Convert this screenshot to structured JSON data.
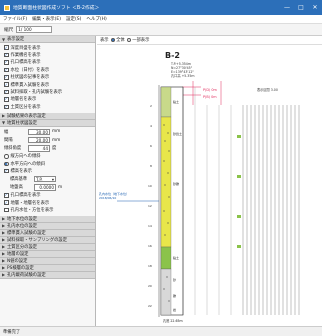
{
  "window": {
    "title": "地質断面柱状図作成ソフト ＜B-2作成＞",
    "controls": {
      "minimize": "—",
      "maximize": "□",
      "close": "✕"
    }
  },
  "menu": [
    "ファイル(F)",
    "編集・表示(E)",
    "設定(S)",
    "ヘルプ(H)"
  ],
  "toolbar": {
    "scale_label": "縮尺",
    "scale_value": "1/ 100"
  },
  "left_panel": {
    "display_settings": {
      "header": "表示設定",
      "items": [
        {
          "label": "深度目盛を表示",
          "checked": true
        },
        {
          "label": "作業機名を表示",
          "checked": true
        },
        {
          "label": "孔口標高を表示",
          "checked": true
        },
        {
          "label": "水位（日付）を表示",
          "checked": true
        },
        {
          "label": "柱状図の記事を表示",
          "checked": true
        },
        {
          "label": "標準貫入試験を表示",
          "checked": true
        },
        {
          "label": "試料採取・孔内試験を表示",
          "checked": true
        },
        {
          "label": "地層名を表示",
          "checked": true
        },
        {
          "label": "土質区分を表示",
          "checked": true
        }
      ]
    },
    "test_display_header": "試験結果の表示設定",
    "geology_settings": {
      "header": "地質柱状図設定",
      "width_label": "幅",
      "width_value": "30.00",
      "width_unit": "mm",
      "spacing_label": "間隔",
      "spacing_value": "20.00",
      "spacing_unit": "mm",
      "angle_label": "傾斜角度",
      "angle_value": "44",
      "angle_unit": "度",
      "radio_options": [
        {
          "label": "縦方向への傾斜",
          "selected": false
        },
        {
          "label": "水平方向への傾斜",
          "selected": true
        }
      ],
      "elevation_checkbox": "標高を表示",
      "elevation_ref_label": "標高基準",
      "elevation_ref_value": "T.P.",
      "ground_level_label": "地盤高",
      "ground_level_value": "0.0000",
      "ground_level_unit": "m",
      "extra_items": [
        {
          "label": "孔口標高を表示",
          "checked": true
        },
        {
          "label": "地層・地層名を表示",
          "checked": true
        },
        {
          "label": "孔内水位・方位を表示",
          "checked": false
        }
      ]
    },
    "collapsed_sections": [
      "地下水位の設定",
      "孔内水位の設定",
      "標準貫入試験の設定",
      "試料採取・サンプリングの設定",
      "土質区分の設定",
      "地層の設定",
      "N値の設定",
      "PS検層の設定",
      "孔内載荷試験の設定"
    ]
  },
  "main": {
    "view_label": "表示",
    "view_options": [
      {
        "label": "全体",
        "selected": true
      },
      {
        "label": "一部表示",
        "selected": false
      }
    ]
  },
  "drawing": {
    "borehole_name": "B-2",
    "header_info": [
      "T.P.+5.354m",
      "N=27°30'45\"",
      "E=139°43'12\"",
      "孔口高 +5.35m"
    ],
    "notes_top": "P(D) 0m",
    "notes_second": "P(B) 0m",
    "left_label": "孔内水位（地下水位）",
    "left_date": "2018/06/10",
    "side_note": "表示区間  3.00",
    "depth_ticks": [
      "2",
      "4",
      "6",
      "8",
      "10",
      "12",
      "14",
      "16",
      "18",
      "20",
      "22"
    ],
    "layer_labels": [
      "粘土",
      "砂質土",
      "砂礫",
      "粘土",
      "砂",
      "礫",
      "岩"
    ],
    "bottom_label": "孔底 22.65m",
    "accent_colors": {
      "titlebar": "#2c6fb9",
      "gravel": "#e8e64a",
      "clay": "#8bc34a",
      "marker": "#e0285a"
    }
  },
  "status": {
    "text": "準備完了"
  }
}
